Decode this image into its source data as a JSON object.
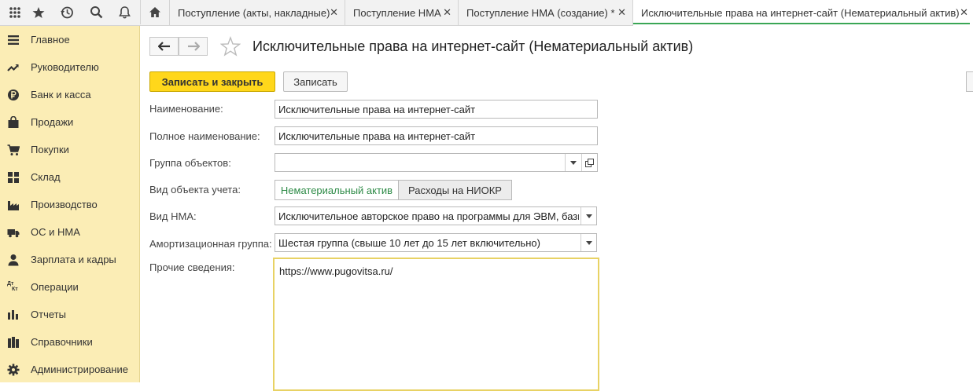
{
  "topbar": {
    "icons": [
      "apps-grid-icon",
      "star-icon",
      "history-icon",
      "search-icon",
      "bell-icon",
      "home-icon"
    ],
    "tabs": [
      {
        "label": "Поступление (акты, накладные)",
        "close": "✕"
      },
      {
        "label": "Поступление НМА",
        "close": "✕"
      },
      {
        "label": "Поступление НМА (создание) *",
        "close": "✕"
      },
      {
        "label": "Исключительные права на интернет-сайт (Нематериальный актив)",
        "close": "✕"
      }
    ]
  },
  "sidebar": {
    "items": [
      {
        "label": "Главное",
        "icon": "menu-icon"
      },
      {
        "label": "Руководителю",
        "icon": "trend-icon"
      },
      {
        "label": "Банк и касса",
        "icon": "ruble-icon"
      },
      {
        "label": "Продажи",
        "icon": "bag-icon"
      },
      {
        "label": "Покупки",
        "icon": "cart-icon"
      },
      {
        "label": "Склад",
        "icon": "warehouse-icon"
      },
      {
        "label": "Производство",
        "icon": "factory-icon"
      },
      {
        "label": "ОС и НМА",
        "icon": "truck-icon"
      },
      {
        "label": "Зарплата и кадры",
        "icon": "person-icon"
      },
      {
        "label": "Операции",
        "icon": "dt-kt-icon"
      },
      {
        "label": "Отчеты",
        "icon": "bar-chart-icon"
      },
      {
        "label": "Справочники",
        "icon": "books-icon"
      },
      {
        "label": "Администрирование",
        "icon": "gear-icon"
      }
    ],
    "dt_kt": {
      "top": "Дт",
      "bottom": "Кт"
    }
  },
  "form": {
    "title": "Исключительные права на интернет-сайт (Нематериальный актив)",
    "save_close_label": "Записать и закрыть",
    "save_label": "Записать",
    "fields": {
      "name": {
        "label": "Наименование:",
        "value": "Исключительные права на интернет-сайт"
      },
      "full_name": {
        "label": "Полное наименование:",
        "value": "Исключительные права на интернет-сайт"
      },
      "group": {
        "label": "Группа объектов:",
        "value": ""
      },
      "account_type": {
        "label": "Вид объекта учета:",
        "option_selected": "Нематериальный актив",
        "option_other": "Расходы на НИОКР"
      },
      "nma_type": {
        "label": "Вид НМА:",
        "value": "Исключительное авторское право на программы для ЭВМ, базы"
      },
      "amort_group": {
        "label": "Амортизационная группа:",
        "value": "Шестая группа (свыше 10 лет до 15 лет включительно)"
      },
      "other_info": {
        "label": "Прочие сведения:",
        "value": "https://www.pugovitsa.ru/"
      }
    }
  },
  "colors": {
    "sidebar_bg": "#fbedb5",
    "primary_button": "#ffd71b",
    "accent_green": "#2e8b47",
    "active_tab_underline": "#3aa655"
  }
}
